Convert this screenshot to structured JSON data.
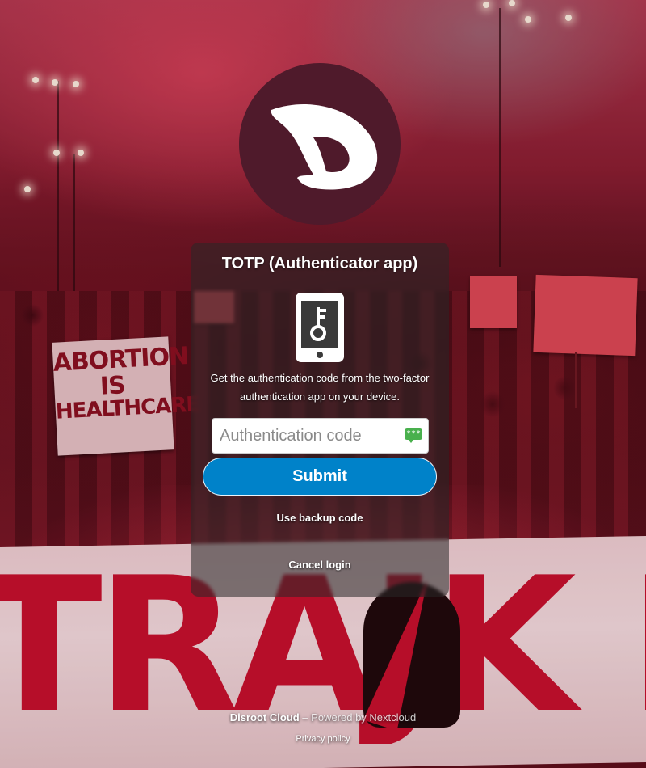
{
  "logo": {
    "icon": "diaspora-d-logo",
    "color": "#4f1a2b"
  },
  "panel": {
    "title": "TOTP (Authenticator app)",
    "icon": "phone-key-icon",
    "description": "Get the authentication code from the two-factor authentication app on your device.",
    "code_input": {
      "value": "",
      "placeholder": "Authentication code"
    },
    "password_manager_icon": "password-manager-icon",
    "submit_label": "Submit",
    "backup_code_link": "Use backup code",
    "cancel_link": "Cancel login"
  },
  "footer": {
    "brand": "Disroot Cloud",
    "separator": " – Powered by ",
    "powered_by": "Nextcloud",
    "privacy": "Privacy policy"
  },
  "background": {
    "protest_sign": [
      "ABORTION",
      "IS",
      "HEALTHCARE"
    ],
    "banner_text": "TRAJK KO"
  },
  "colors": {
    "primary": "#0082c9",
    "logo_bg": "#4f1a2b"
  }
}
